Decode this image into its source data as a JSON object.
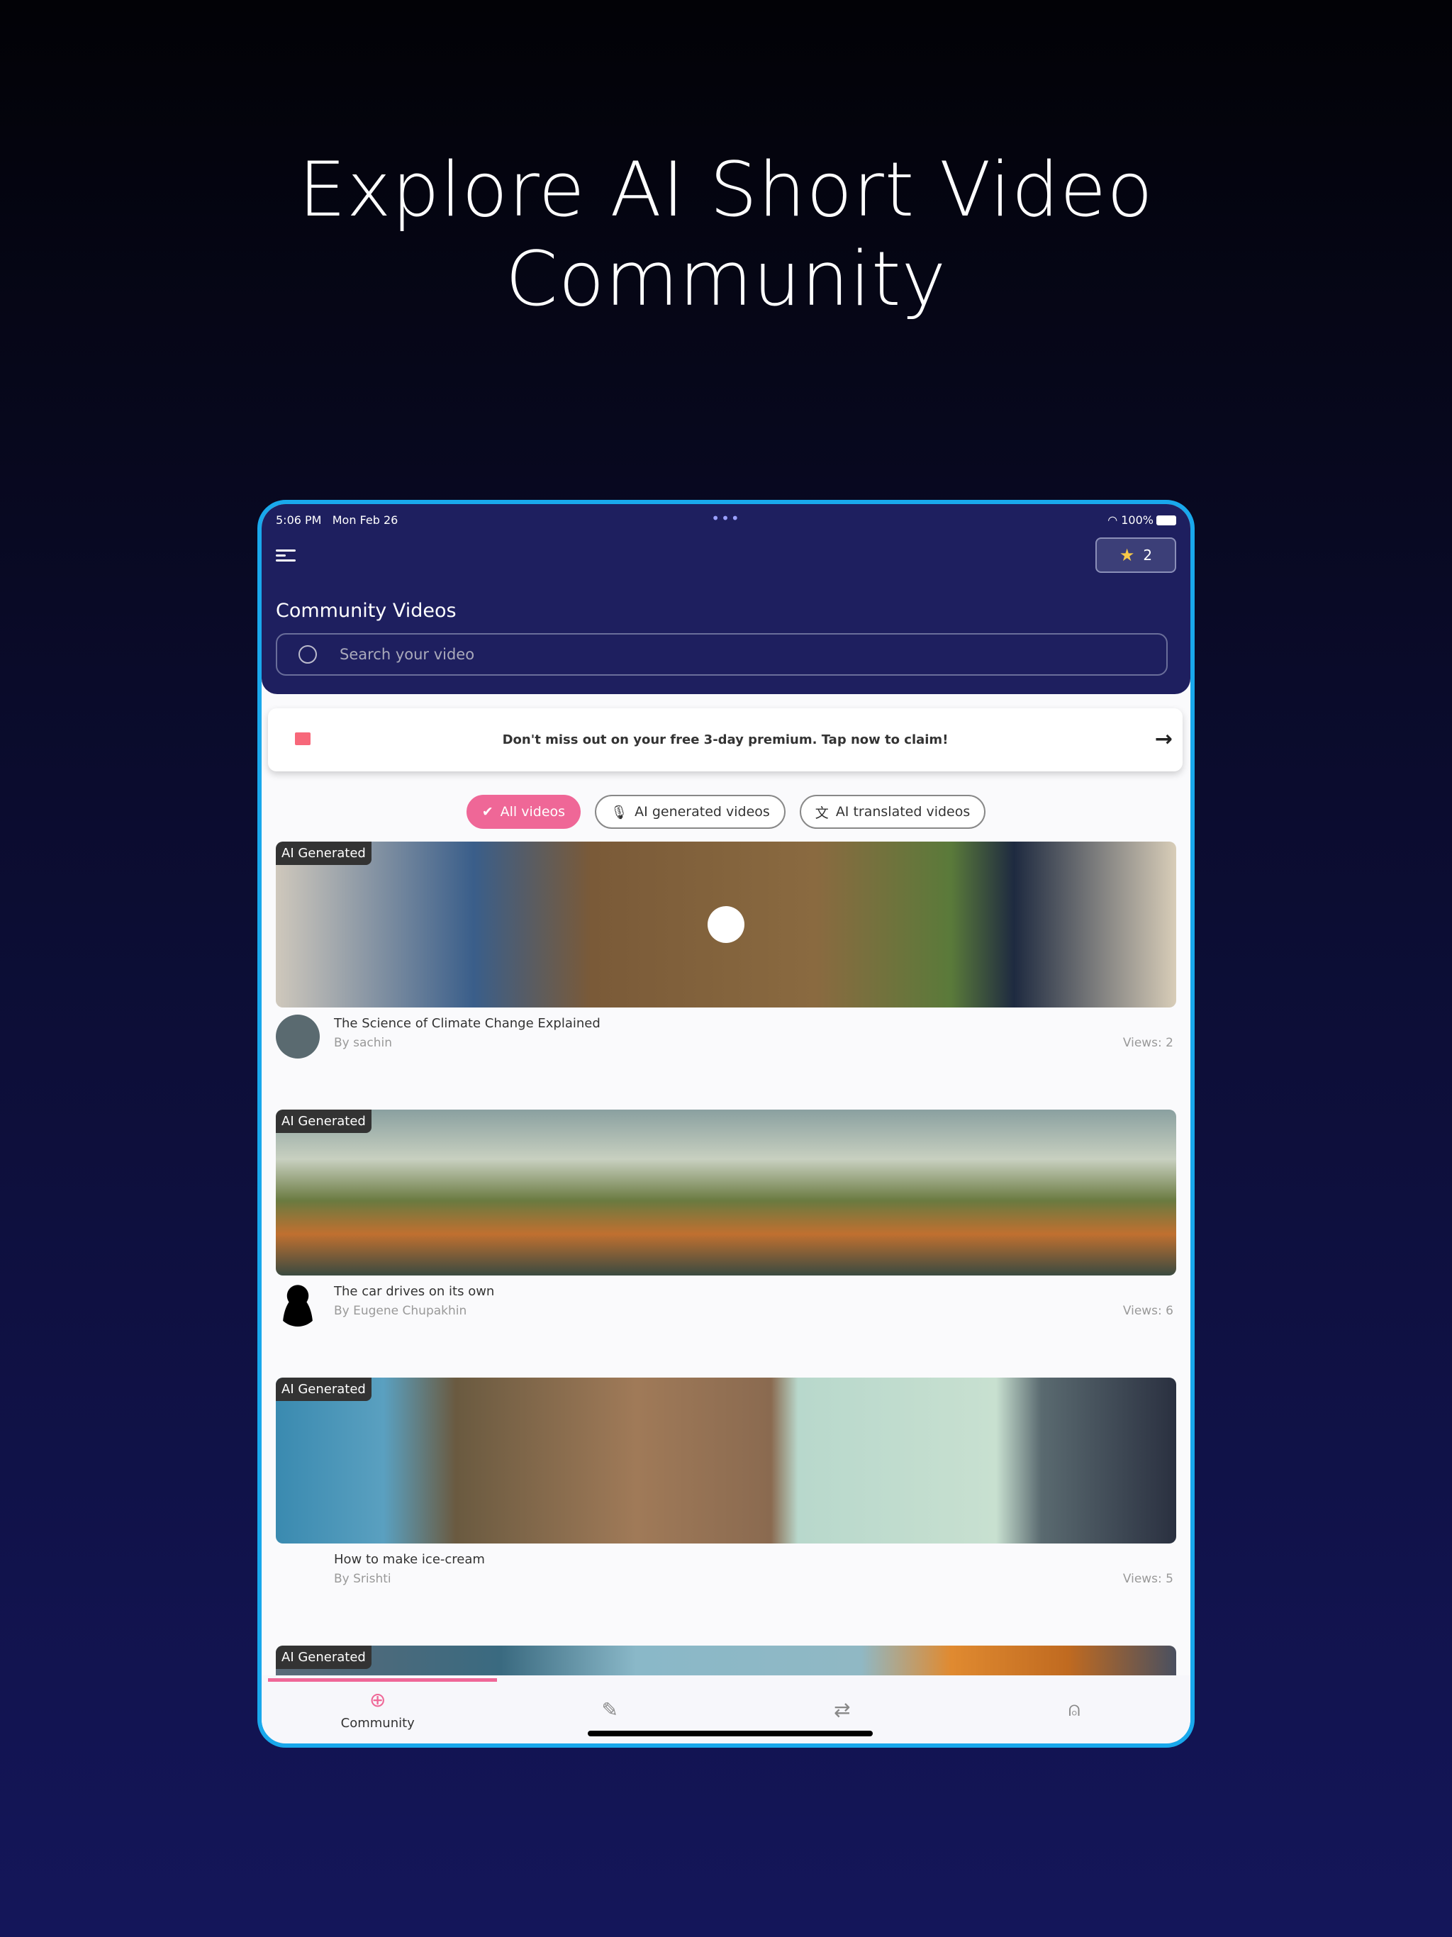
{
  "hero": {
    "line1": "Explore AI Short Video",
    "line2": "Community"
  },
  "status": {
    "time": "5:06 PM",
    "date": "Mon Feb 26",
    "battery": "100%"
  },
  "header": {
    "title": "Community Videos",
    "stars": "2",
    "search_placeholder": "Search your video"
  },
  "banner": {
    "text": "Don't miss out on your free 3-day premium. Tap now to claim!"
  },
  "filters": [
    {
      "label": "All videos",
      "active": true
    },
    {
      "label": "AI generated videos"
    },
    {
      "label": "AI translated videos"
    }
  ],
  "videos": [
    {
      "badge": "AI Generated",
      "title": "The Science of Climate Change Explained",
      "author": "By sachin",
      "views": "Views: 2"
    },
    {
      "badge": "AI Generated",
      "title": "The car drives on its own",
      "author": "By Eugene Chupakhin",
      "views": "Views: 6"
    },
    {
      "badge": "AI Generated",
      "title": "How to make ice-cream",
      "author": "By Srishti",
      "views": "Views: 5"
    },
    {
      "badge": "AI Generated"
    }
  ],
  "nav": {
    "community": "Community"
  },
  "colors": {
    "accent": "#ef6797",
    "header": "#1e1f5f",
    "frame": "#19a8ec"
  }
}
